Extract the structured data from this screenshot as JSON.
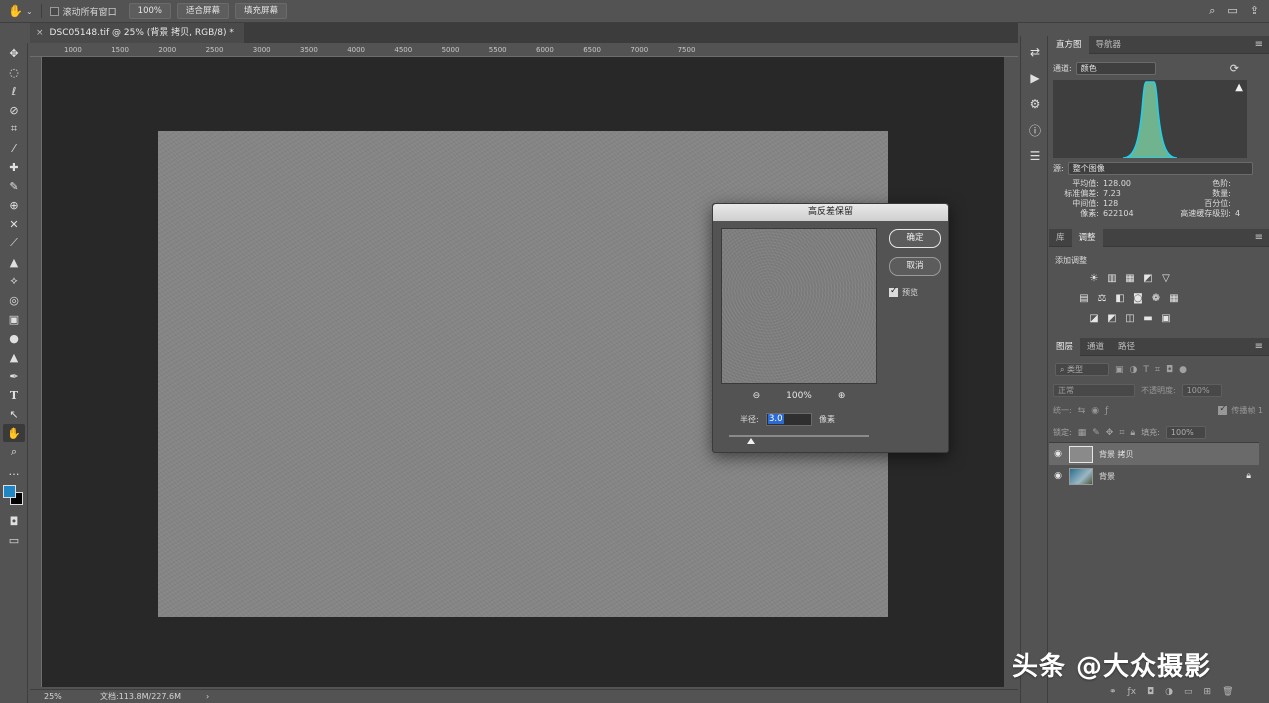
{
  "options_bar": {
    "scroll_all_label": "滚动所有窗口",
    "zoom_100": "100%",
    "fit_screen": "适合屏幕",
    "fill_screen": "填充屏幕"
  },
  "document_tab": {
    "close": "×",
    "title": "DSC05148.tif @ 25% (背景 拷贝, RGB/8) *"
  },
  "ruler": {
    "h_ticks": [
      "1000",
      "1500",
      "2000",
      "2500",
      "3000",
      "3500",
      "4000",
      "4500",
      "5000",
      "5500",
      "6000",
      "6500",
      "7000",
      "7500"
    ]
  },
  "status_bar": {
    "zoom": "25%",
    "doc_info": "文档:113.8M/227.6M",
    "arrow": "›"
  },
  "histogram_panel": {
    "tabs": [
      "直方图",
      "导航器"
    ],
    "channel_label": "通道:",
    "channel_value": "颜色",
    "source_label": "源:",
    "source_value": "整个图像",
    "stats_left": [
      {
        "k": "平均值:",
        "v": "128.00"
      },
      {
        "k": "标准偏差:",
        "v": "7.23"
      },
      {
        "k": "中间值:",
        "v": "128"
      },
      {
        "k": "像素:",
        "v": "622104"
      }
    ],
    "stats_right": [
      {
        "k": "色阶:",
        "v": ""
      },
      {
        "k": "数量:",
        "v": ""
      },
      {
        "k": "百分位:",
        "v": ""
      },
      {
        "k": "高速缓存级别:",
        "v": "4"
      }
    ],
    "warning": "▲"
  },
  "adjustments_panel": {
    "tabs": [
      "库",
      "调整"
    ],
    "add_label": "添加调整"
  },
  "layers_panel": {
    "tabs": [
      "图层",
      "通道",
      "路径"
    ],
    "filter_placeholder": "类型",
    "blend_mode": "正常",
    "opacity_label": "不透明度:",
    "opacity_value": "100%",
    "unify_label": "统一:",
    "propagate_label": "传播帧 1",
    "lock_label": "锁定:",
    "fill_label": "填充:",
    "fill_value": "100%",
    "layers": [
      {
        "name": "背景 拷贝",
        "selected": true
      },
      {
        "name": "背景",
        "selected": false
      }
    ]
  },
  "dialog": {
    "title": "高反差保留",
    "ok": "确定",
    "cancel": "取消",
    "preview_label": "预览",
    "zoom_value": "100%",
    "radius_label": "半径:",
    "radius_value": "3.0",
    "unit": "像素"
  },
  "watermark": "头条 @大众摄影",
  "colors": {
    "foreground": "#1e86c4",
    "background": "#000000"
  }
}
